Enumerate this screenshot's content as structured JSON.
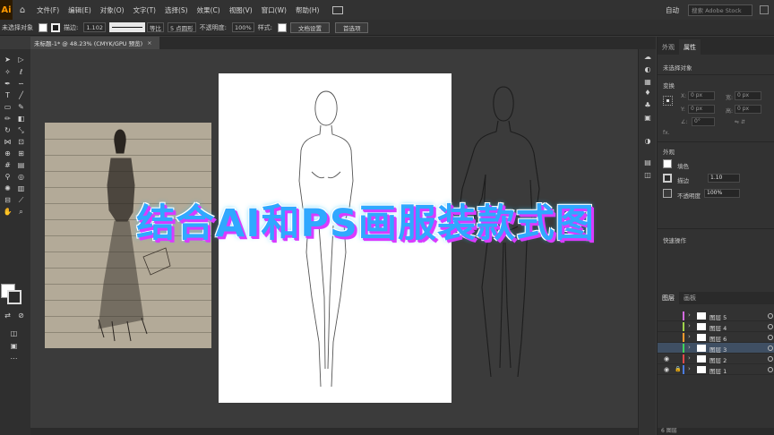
{
  "app": {
    "logo_text": "Ai"
  },
  "menu": {
    "items": [
      {
        "label": "文件(F)"
      },
      {
        "label": "编辑(E)"
      },
      {
        "label": "对象(O)"
      },
      {
        "label": "文字(T)"
      },
      {
        "label": "选择(S)"
      },
      {
        "label": "效果(C)"
      },
      {
        "label": "视图(V)"
      },
      {
        "label": "窗口(W)"
      },
      {
        "label": "帮助(H)"
      }
    ],
    "workspace_label": "自动",
    "stock_search_placeholder": "搜索 Adobe Stock"
  },
  "controlbar": {
    "no_selection": "未选择对象",
    "stroke_label": "描边:",
    "stroke_value": "1.102",
    "stroke_profile": "等比",
    "brush_label": "5 点圆形",
    "opacity_label": "不透明度:",
    "opacity_value": "100%",
    "style_label": "样式:",
    "doc_setup_button": "文档设置",
    "preferences_button": "首选项"
  },
  "document_tab": {
    "title": "未标题-1* @ 48.23% (CMYK/GPU 预览)",
    "close": "×"
  },
  "overlay_title": "结合AI和PS画服装款式图",
  "panel": {
    "tabs": [
      {
        "label": "外观",
        "active": false
      },
      {
        "label": "属性",
        "active": true
      }
    ],
    "no_selection": "未选择对象",
    "transform_heading": "变换",
    "x_label": "X:",
    "x_value": "0 px",
    "y_label": "Y:",
    "y_value": "0 px",
    "w_label": "宽:",
    "w_value": "0 px",
    "h_label": "高:",
    "h_value": "0 px",
    "angle_label": "∠:",
    "angle_value": "0°",
    "fx_label": "fx.",
    "appearance_heading": "外观",
    "fill_label": "填色",
    "stroke_label": "描边",
    "stroke_value": "1.10",
    "opacity_label": "不透明度",
    "opacity_value": "100%",
    "quick_actions_heading": "快速操作",
    "layers_tabs": [
      {
        "label": "图层",
        "active": true
      },
      {
        "label": "画板",
        "active": false
      }
    ],
    "layers": [
      {
        "name": "图层 5",
        "color": "#d36ae0",
        "visible": false,
        "locked": false,
        "selected": false
      },
      {
        "name": "图层 4",
        "color": "#9fd34a",
        "visible": false,
        "locked": false,
        "selected": false
      },
      {
        "name": "图层 6",
        "color": "#ff9a2e",
        "visible": false,
        "locked": false,
        "selected": false
      },
      {
        "name": "图层 3",
        "color": "#3ed35d",
        "visible": false,
        "locked": false,
        "selected": true
      },
      {
        "name": "图层 2",
        "color": "#e04848",
        "visible": true,
        "locked": false,
        "selected": false
      },
      {
        "name": "图层 1",
        "color": "#4a7be0",
        "visible": true,
        "locked": true,
        "selected": false
      }
    ],
    "layers_count": "6 图层"
  },
  "icons": {
    "home": "home-icon",
    "grid": "arrange-documents-icon",
    "eye": "eye-icon",
    "lock": "lock-icon"
  },
  "colors": {
    "title_main": "#2fa8ff",
    "title_shadow": "#d93bff",
    "selected_layer": "#3f4f63"
  }
}
